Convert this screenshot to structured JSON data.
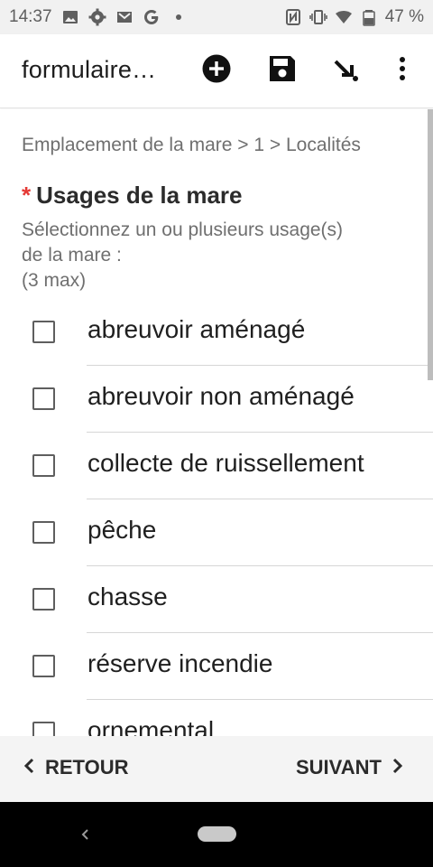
{
  "status_bar": {
    "time": "14:37",
    "left_icons": [
      "image-icon",
      "settings-icon",
      "gmail-icon",
      "google-icon",
      "dot-icon"
    ],
    "right_icons": [
      "nfc-icon",
      "vibrate-icon",
      "wifi-icon",
      "battery-icon"
    ],
    "battery": "47 %"
  },
  "toolbar": {
    "title": "formulaire…",
    "actions": [
      "add-icon",
      "save-icon",
      "arrow-down-right-icon",
      "more-vert-icon"
    ]
  },
  "form": {
    "breadcrumb": "Emplacement de la mare > 1 > Localités",
    "required_mark": "*",
    "question": "Usages de la mare",
    "hint_lines": [
      "Sélectionnez un ou plusieurs usage(s)",
      "de la mare :",
      "(3 max)"
    ],
    "options": [
      {
        "label": "abreuvoir aménagé",
        "checked": false
      },
      {
        "label": "abreuvoir non aménagé",
        "checked": false
      },
      {
        "label": "collecte de ruissellement",
        "checked": false
      },
      {
        "label": "pêche",
        "checked": false
      },
      {
        "label": "chasse",
        "checked": false
      },
      {
        "label": "réserve incendie",
        "checked": false
      },
      {
        "label": "ornemental",
        "checked": false
      }
    ]
  },
  "bottom_nav": {
    "back_label": "RETOUR",
    "next_label": "SUIVANT"
  }
}
